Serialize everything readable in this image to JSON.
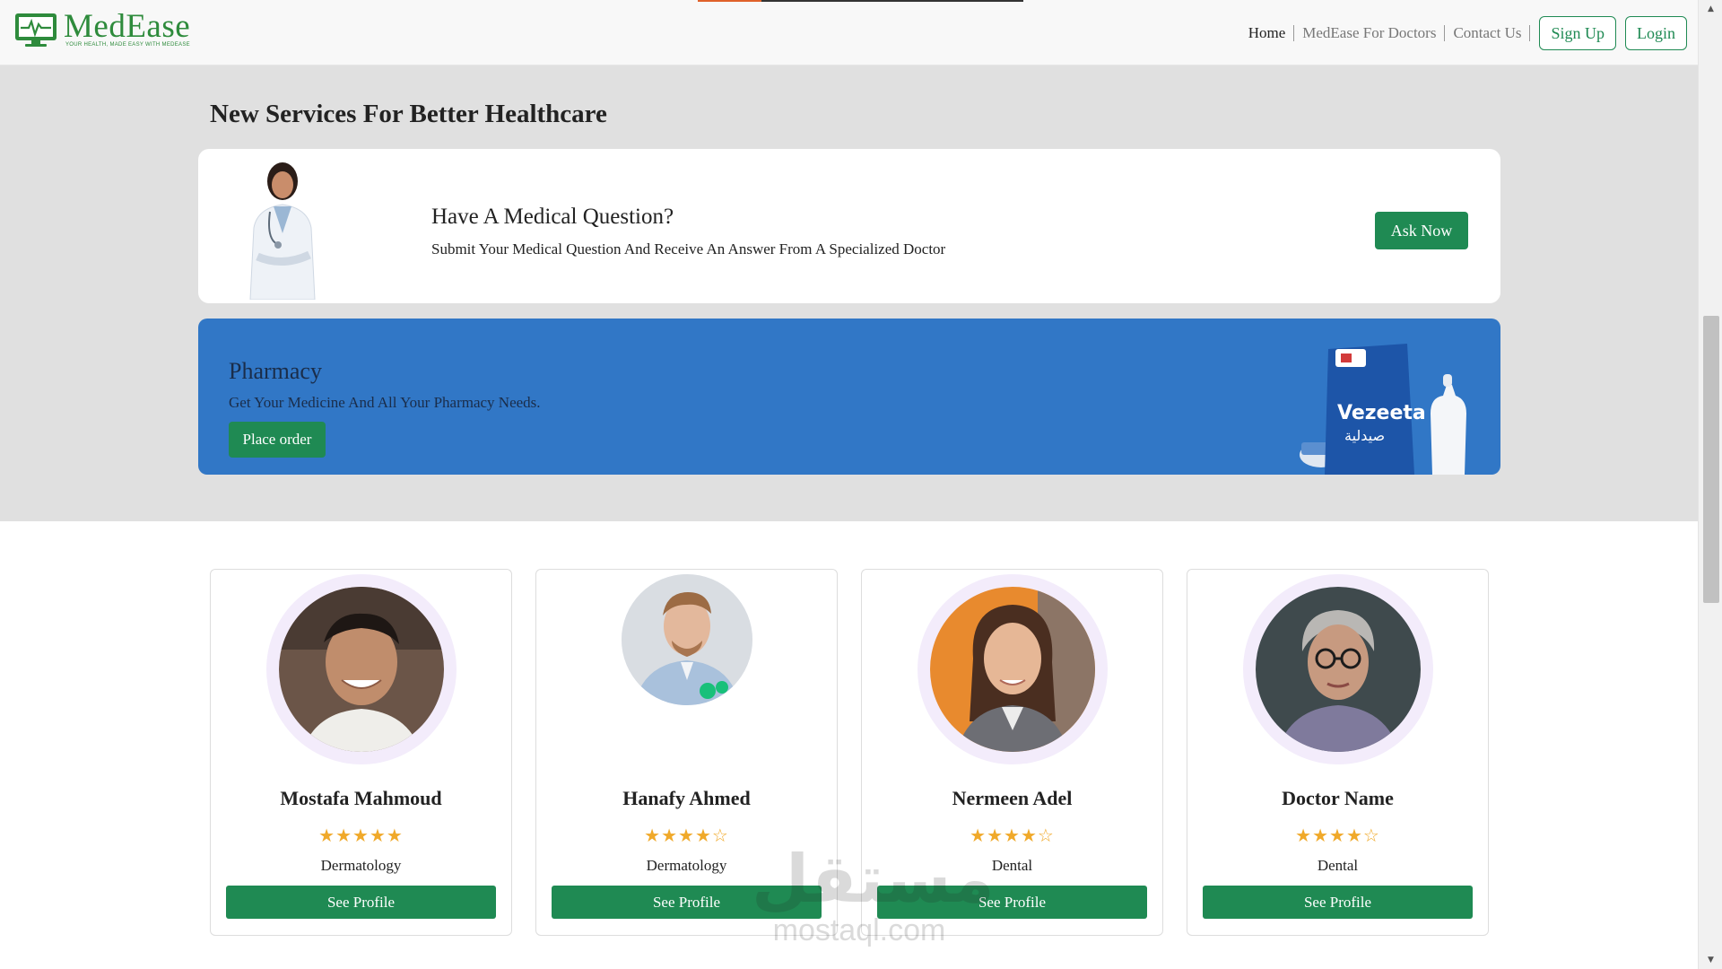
{
  "header": {
    "logo": {
      "name": "MedEase",
      "tagline": "YOUR HEALTH, MADE EASY WITH MEDEASE"
    },
    "nav": [
      {
        "label": "Home",
        "active": true
      },
      {
        "label": "MedEase For Doctors",
        "active": false
      },
      {
        "label": "Contact Us",
        "active": false
      }
    ],
    "signup_label": "Sign Up",
    "login_label": "Login",
    "accent_color": "#2e8b3c"
  },
  "services": {
    "title": "New Services For Better Healthcare",
    "question_card": {
      "title": "Have A Medical Question?",
      "subtitle": "Submit Your Medical Question And Receive An Answer From A Specialized Doctor",
      "button_label": "Ask Now"
    },
    "pharmacy_card": {
      "title": "Pharmacy",
      "subtitle": "Get Your Medicine And All Your Pharmacy Needs.",
      "button_label": "Place order",
      "product_brand": "Vezeeta",
      "product_arabic": "صيدلية",
      "background_color": "#3177c6"
    }
  },
  "doctors": [
    {
      "name": "Mostafa Mahmoud",
      "stars": "★★★★★",
      "rating": 5,
      "specialty": "Dermatology",
      "button_label": "See Profile"
    },
    {
      "name": "Hanafy Ahmed",
      "stars": "★★★★☆",
      "rating": 4,
      "specialty": "Dermatology",
      "button_label": "See Profile"
    },
    {
      "name": "Nermeen Adel",
      "stars": "★★★★☆",
      "rating": 4,
      "specialty": "Dental",
      "button_label": "See Profile"
    },
    {
      "name": "Doctor Name",
      "stars": "★★★★☆",
      "rating": 4,
      "specialty": "Dental",
      "button_label": "See Profile"
    }
  ],
  "watermark": {
    "arabic": "مستقل",
    "latin": "mostaql.com"
  },
  "colors": {
    "primary_button": "#1f8a53",
    "star": "#f0a92a",
    "section_bg": "#e0e0e0"
  }
}
